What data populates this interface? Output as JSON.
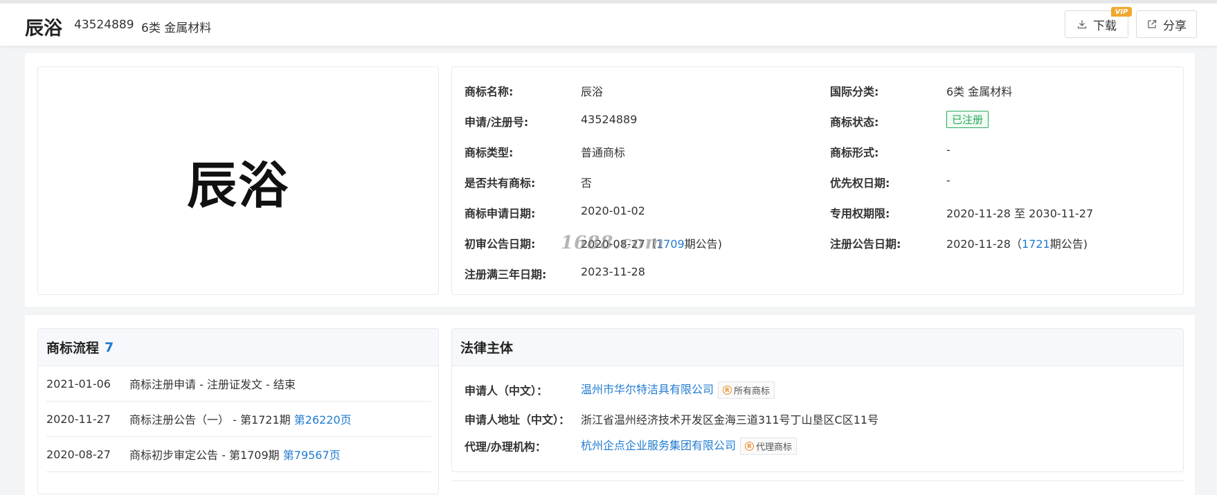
{
  "header": {
    "title": "辰浴",
    "reg_number": "43524889",
    "class": "6类 金属材料",
    "download_label": "下载",
    "vip_badge": "VIP",
    "share_label": "分享"
  },
  "logo_text": "辰浴",
  "watermark": "1688.com",
  "info_left": [
    {
      "label": "商标名称:",
      "value": "辰浴"
    },
    {
      "label": "申请/注册号:",
      "value": "43524889"
    },
    {
      "label": "商标类型:",
      "value": "普通商标"
    },
    {
      "label": "是否共有商标:",
      "value": "否"
    },
    {
      "label": "商标申请日期:",
      "value": "2020-01-02"
    },
    {
      "label": "初审公告日期:",
      "value_pre": "2020-08-27（",
      "value_link": "1709",
      "value_post": "期公告)"
    },
    {
      "label": "注册满三年日期:",
      "value": "2023-11-28"
    }
  ],
  "info_right": [
    {
      "label": "国际分类:",
      "value": "6类 金属材料"
    },
    {
      "label": "商标状态:",
      "value": "已注册"
    },
    {
      "label": "商标形式:",
      "value": "-"
    },
    {
      "label": "优先权日期:",
      "value": "-"
    },
    {
      "label": "专用权期限:",
      "value": "2020-11-28 至 2030-11-27"
    },
    {
      "label": "注册公告日期:",
      "value_pre": "2020-11-28（",
      "value_link": "1721",
      "value_post": "期公告)"
    }
  ],
  "status_color": "#2bab5b",
  "flow": {
    "title": "商标流程",
    "count": "7",
    "items": [
      {
        "date": "2021-01-06",
        "text": "商标注册申请 - 注册证发文 - 结束",
        "link": ""
      },
      {
        "date": "2020-11-27",
        "text": "商标注册公告（一） - 第1721期 ",
        "link": "第26220页"
      },
      {
        "date": "2020-08-27",
        "text": "商标初步审定公告 - 第1709期 ",
        "link": "第79567页"
      }
    ]
  },
  "legal": {
    "title": "法律主体",
    "applicant_label": "申请人（中文）：",
    "applicant": "温州市华尔特洁具有限公司",
    "applicant_tag": "所有商标",
    "address_label": "申请人地址（中文）：",
    "address": "浙江省温州经济技术开发区金海三道311号丁山垦区C区11号",
    "agent_label": "代理/办理机构：",
    "agent": "杭州企点企业服务集团有限公司",
    "agent_tag": "代理商标"
  },
  "accent_color": "#1f7bd1",
  "vip_color": "#f0a830"
}
